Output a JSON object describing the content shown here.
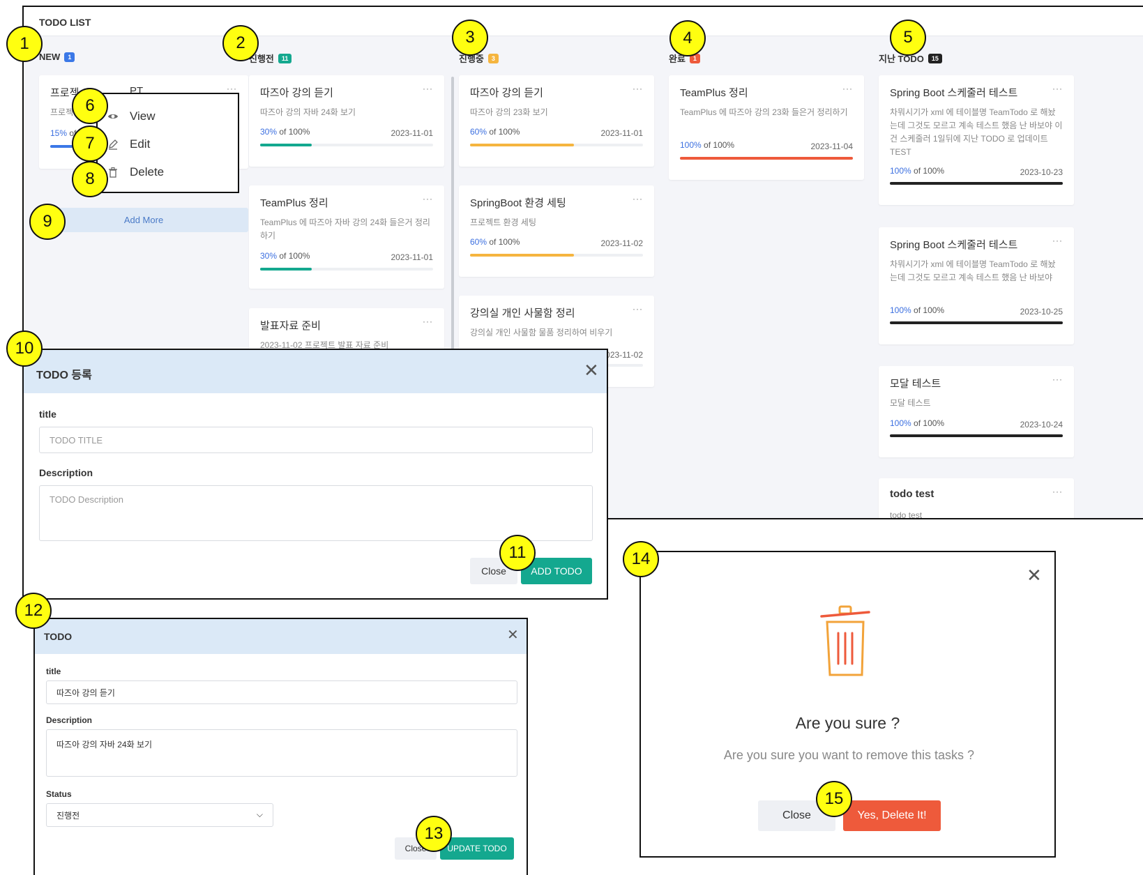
{
  "board": {
    "title": "TODO LIST",
    "columns": [
      {
        "name": "NEW",
        "count": "1",
        "color": "#3b78e7"
      },
      {
        "name": "진행전",
        "count": "11",
        "color": "#14a88f"
      },
      {
        "name": "진행중",
        "count": "3",
        "color": "#f5b53f"
      },
      {
        "name": "완료",
        "count": "1",
        "color": "#ee5a3b"
      },
      {
        "name": "지난 TODO",
        "count": "15",
        "color": "#222222"
      }
    ],
    "new_card": {
      "title": "프로젝トPPT",
      "title_visible": "프로젝",
      "title_tail": "PT",
      "desc": "프로젝",
      "progress": "15%",
      "progress_tail": "of",
      "fill": 0.15
    },
    "add_more": "Add More",
    "cards_todo": [
      {
        "title": "따즈아 강의 듣기",
        "desc": "따즈아 강의 자바 24화 보기",
        "progress": "30%",
        "of": "of 100%",
        "date": "2023-11-01",
        "fill": 0.3
      },
      {
        "title": "TeamPlus 정리",
        "desc": "TeamPlus 에 따즈아 자바 강의 24화 들은거 정리하기",
        "progress": "30%",
        "of": "of 100%",
        "date": "2023-11-01",
        "fill": 0.3
      },
      {
        "title": "발표자료 준비",
        "desc": "2023-11-02 프로젝트 발표 자료 준비"
      }
    ],
    "cards_doing": [
      {
        "title": "따즈아 강의 듣기",
        "desc": "따즈아 강의 23화 보기",
        "progress": "60%",
        "of": "of 100%",
        "date": "2023-11-01",
        "fill": 0.6
      },
      {
        "title": "SpringBoot 환경 세팅",
        "desc": "프로젝트 환경 세팅",
        "progress": "60%",
        "of": "of 100%",
        "date": "2023-11-02",
        "fill": 0.6
      },
      {
        "title": "강의실 개인 사물함 정리",
        "desc": "강의실 개인 사물함 물품 정리하여 비우기",
        "date": "2023-11-02"
      }
    ],
    "cards_done": [
      {
        "title": "TeamPlus 정리",
        "desc": "TeamPlus 에 따즈아 강의 23화 들은거 정리하기",
        "progress": "100%",
        "of": "of 100%",
        "date": "2023-11-04",
        "fill": 1.0
      }
    ],
    "cards_past": [
      {
        "title": "Spring Boot 스케줄러 테스트",
        "desc": "차뭐시기가 xml 에 테이블명 TeamTodo 로 해놨는데 그것도 모르고 계속 테스트 했음 난 바보야 이건 스케줄러 1일뒤에 지난 TODO 로 업데이트 TEST",
        "progress": "100%",
        "of": "of 100%",
        "date": "2023-10-23",
        "fill": 1.0
      },
      {
        "title": "Spring Boot 스케줄러 테스트",
        "desc": "차뭐시기가 xml 에 테이블명 TeamTodo 로 해놨는데 그것도 모르고 계속 테스트 했음 난 바보야",
        "progress": "100%",
        "of": "of 100%",
        "date": "2023-10-25",
        "fill": 1.0
      },
      {
        "title": "모달 테스트",
        "desc": "모달 테스트",
        "progress": "100%",
        "of": "of 100%",
        "date": "2023-10-24",
        "fill": 1.0
      },
      {
        "title": "todo test",
        "desc": "todo test"
      }
    ],
    "dots": "···"
  },
  "context_menu": {
    "view": "View",
    "edit": "Edit",
    "delete": "Delete"
  },
  "add_modal": {
    "title": "TODO 등록",
    "title_label": "title",
    "title_placeholder": "TODO TITLE",
    "desc_label": "Description",
    "desc_placeholder": "TODO Description",
    "close": "Close",
    "submit": "ADD TODO"
  },
  "edit_modal": {
    "title": "TODO",
    "title_label": "title",
    "title_value": "따즈아 강의 듣기",
    "desc_label": "Description",
    "desc_value": "따즈아 강의 자바 24화 보기",
    "status_label": "Status",
    "status_value": "진행전",
    "close": "Close",
    "submit": "UPDATE TODO"
  },
  "delete_modal": {
    "title": "Are you sure ?",
    "text": "Are you sure you want to remove this tasks ?",
    "close": "Close",
    "confirm": "Yes, Delete It!"
  },
  "markers": [
    "1",
    "2",
    "3",
    "4",
    "5",
    "6",
    "7",
    "8",
    "9",
    "10",
    "11",
    "12",
    "13",
    "14",
    "15"
  ]
}
